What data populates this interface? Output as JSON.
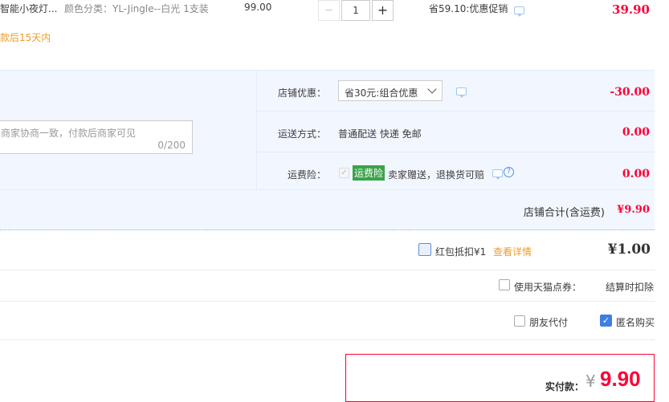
{
  "item": {
    "title": "智能小夜灯...",
    "spec": "颜色分类：YL-Jingle--白光 1支装",
    "after_sale": "款后15天内",
    "unit_price": "99.00",
    "quantity": "1",
    "minus": "−",
    "plus": "+",
    "promo": "省59.10:优惠促销",
    "subtotal": "39.90"
  },
  "shop": {
    "discount_label": "店铺优惠：",
    "discount_selected": "省30元:组合优惠",
    "discount_amount": "-30.00",
    "message_placeholder": "商家协商一致，付款后商家可见",
    "message_count": "0/200",
    "shipping_label": "运送方式：",
    "shipping_value": "普通配送 快递 免邮",
    "shipping_amount": "0.00",
    "insurance_label": "运费险：",
    "insurance_tag": "运费险",
    "insurance_text": "卖家赠送，退换货可赔",
    "insurance_amount": "0.00",
    "total_label": "店铺合计(含运费)",
    "total_value": "¥9.90"
  },
  "redpacket": {
    "label": "红包抵扣¥1",
    "link": "查看详情",
    "amount": "¥1.00"
  },
  "coupon": {
    "label": "使用天猫点券：",
    "value": "结算时扣除"
  },
  "options": {
    "friend_pay": "朋友代付",
    "anonymous": "匿名购买",
    "anonymous_checked": true
  },
  "pay": {
    "label": "实付款：",
    "currency": "¥",
    "amount": "9.90"
  }
}
